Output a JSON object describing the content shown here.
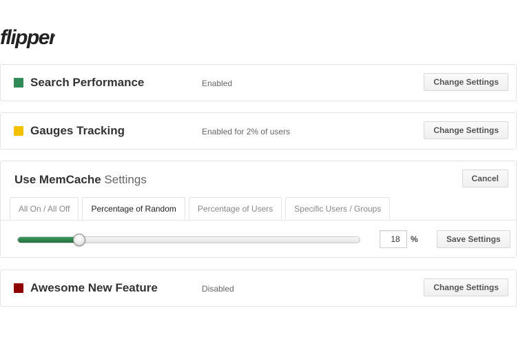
{
  "logo": {
    "text": "flipper"
  },
  "colors": {
    "enabled": "#2f8a56",
    "partial": "#f2c200",
    "disabled": "#8f0000",
    "accent_fill": "#2e8a4c"
  },
  "features": [
    {
      "name": "Search Performance",
      "state": "Enabled",
      "status": "enabled",
      "button": "Change Settings"
    },
    {
      "name": "Gauges Tracking",
      "state": "Enabled for 2% of users",
      "status": "partial",
      "button": "Change Settings"
    },
    {
      "name": "Awesome New Feature",
      "state": "Disabled",
      "status": "disabled",
      "button": "Change Settings"
    }
  ],
  "settings": {
    "feature_name": "Use MemCache",
    "title_suffix": "Settings",
    "cancel_label": "Cancel",
    "tabs": [
      "All On / All Off",
      "Percentage of Random",
      "Percentage of Users",
      "Specific Users / Groups"
    ],
    "active_tab": "Percentage of Random",
    "percentage": 18,
    "percent_value": "18",
    "percent_sign": "%",
    "save_label": "Save Settings"
  }
}
